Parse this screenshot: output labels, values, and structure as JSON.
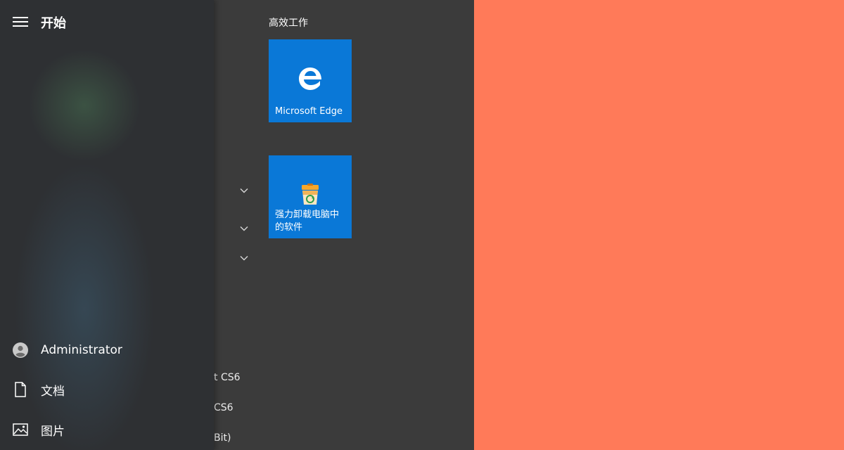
{
  "rail": {
    "title": "开始",
    "user": "Administrator",
    "documents": "文档",
    "pictures": "图片"
  },
  "app_list": {
    "item1": "t CS6",
    "item2": "CS6",
    "item3": "Bit)"
  },
  "tiles": {
    "group_title": "高效工作",
    "edge_label": "Microsoft Edge",
    "uninstall_label": "强力卸载电脑中的软件"
  },
  "colors": {
    "desktop": "#ff7a59",
    "tile": "#0a78d7",
    "menu": "#3b3b3b"
  },
  "icons": [
    "hamburger-icon",
    "user-icon",
    "document-icon",
    "pictures-icon",
    "chevron-down-icon",
    "edge-icon",
    "uninstall-icon"
  ]
}
